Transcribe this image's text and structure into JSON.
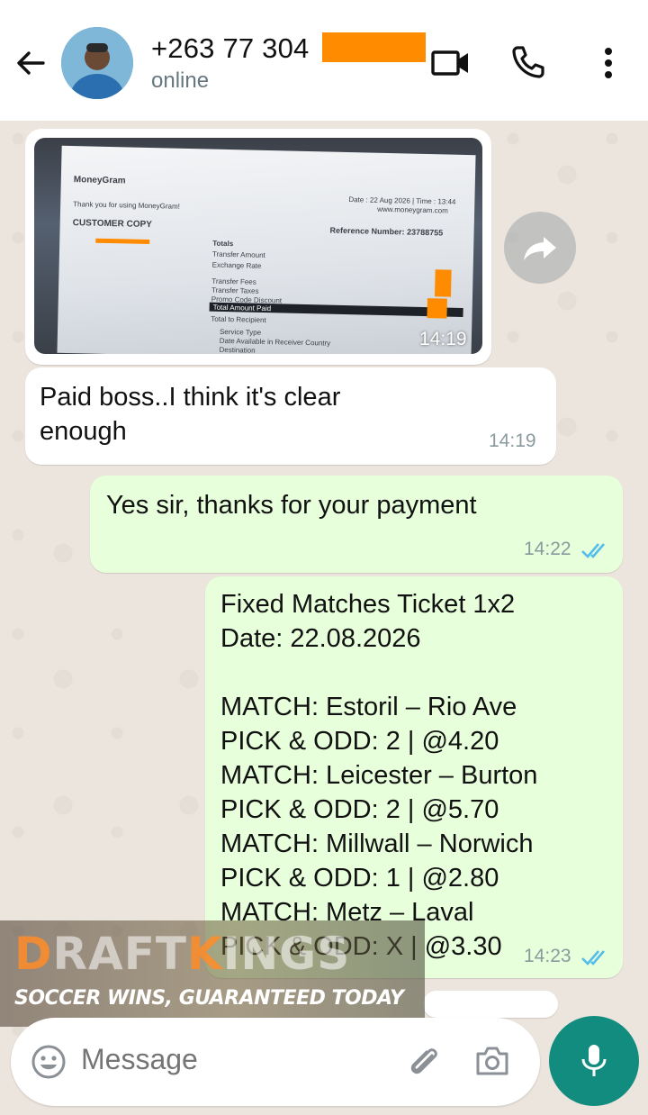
{
  "header": {
    "contact_name": "+263 77 304",
    "status": "online",
    "redaction_color": "#ff8c00"
  },
  "icons": {
    "back": "arrow-left",
    "video": "video-camera",
    "call": "phone",
    "menu": "vertical-dots",
    "forward": "share-forward",
    "emoji": "smiley-face",
    "attach": "paperclip",
    "camera": "camera",
    "mic": "microphone"
  },
  "messages": [
    {
      "type": "image",
      "direction": "incoming",
      "time": "14:19",
      "receipt": {
        "brand": "MoneyGram",
        "thanks": "Thank you for using MoneyGram!",
        "heading": "CUSTOMER COPY",
        "reference": "Reference Number: 23788755",
        "date_line": "Date : 22 Aug 2026 | Time : 13:44",
        "site": "www.moneygram.com",
        "totals": "Totals",
        "rows": [
          "Transfer Amount",
          "Exchange Rate",
          "Transfer Fees",
          "Transfer Taxes",
          "Promo Code Discount",
          "Total Amount Paid",
          "Total to Recipient"
        ],
        "service": [
          "Service Type",
          "Date Available in Receiver Country",
          "Destination"
        ]
      }
    },
    {
      "type": "text",
      "direction": "incoming",
      "text": "Paid boss..I think it's clear\nenough",
      "time": "14:19"
    },
    {
      "type": "text",
      "direction": "outgoing",
      "text": "Yes sir, thanks for your payment",
      "time": "14:22"
    },
    {
      "type": "text",
      "direction": "outgoing",
      "text": "Fixed Matches Ticket 1x2\nDate: 22.08.2026\n\nMATCH: Estoril – Rio Ave\nPICK & ODD: 2 | @4.20\nMATCH: Leicester – Burton\nPICK & ODD: 2 | @5.70\nMATCH: Millwall – Norwich\nPICK & ODD: 1 | @2.80\nMATCH: Metz – Laval\nPICK & ODD: X | @3.30",
      "time": "14:23"
    }
  ],
  "ad": {
    "logo_first": "D",
    "logo_rest1": "RAFT",
    "logo_k": "K",
    "logo_rest2": "INGS",
    "tagline": "SOCCER WINS, GUARANTEED TODAY"
  },
  "composer": {
    "placeholder": "Message"
  },
  "colors": {
    "outgoing_bubble": "#e7ffdb",
    "incoming_bubble": "#ffffff",
    "accent": "#128c7e",
    "read_ticks": "#53bdeb"
  }
}
